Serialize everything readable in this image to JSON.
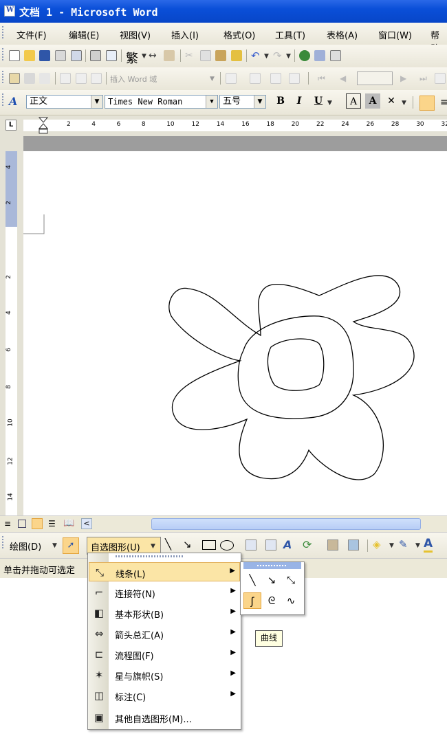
{
  "window": {
    "title": "文档 1 - Microsoft Word"
  },
  "menu": [
    "文件(F)",
    "编辑(E)",
    "视图(V)",
    "插入(I)",
    "格式(O)",
    "工具(T)",
    "表格(A)",
    "窗口(W)",
    "帮助"
  ],
  "std_toolbar": {
    "font_variant_label": "繁"
  },
  "mail_toolbar": {
    "insert_field_label": "插入 Word 域"
  },
  "format_toolbar": {
    "style": "正文",
    "font": "Times New Roman",
    "size": "五号",
    "bold": "B",
    "italic": "I",
    "underline": "U",
    "char_border": "A",
    "char_shade": "A"
  },
  "ruler": {
    "ticks": [
      "2",
      "4",
      "6",
      "8",
      "10",
      "12",
      "14",
      "16",
      "18",
      "20",
      "22",
      "24",
      "26",
      "28",
      "30",
      "32"
    ]
  },
  "vruler": {
    "ticks": [
      "4",
      "2",
      "2",
      "4",
      "6",
      "8",
      "10",
      "12",
      "14"
    ]
  },
  "draw_toolbar": {
    "draw_label": "绘图(D)",
    "autoshapes_label": "自选图形(U)"
  },
  "status": {
    "text": "单击并拖动可选定"
  },
  "autoshapes_menu": {
    "items": [
      {
        "label": "线条(L)",
        "icon": "lines-icon",
        "submenu": true,
        "highlighted": true
      },
      {
        "label": "连接符(N)",
        "icon": "connector-icon",
        "submenu": true
      },
      {
        "label": "基本形状(B)",
        "icon": "basic-shapes-icon",
        "submenu": true
      },
      {
        "label": "箭头总汇(A)",
        "icon": "block-arrows-icon",
        "submenu": true
      },
      {
        "label": "流程图(F)",
        "icon": "flowchart-icon",
        "submenu": true
      },
      {
        "label": "星与旗帜(S)",
        "icon": "stars-banners-icon",
        "submenu": true
      },
      {
        "label": "标注(C)",
        "icon": "callouts-icon",
        "submenu": true
      },
      {
        "label": "其他自选图形(M)...",
        "icon": "more-autoshapes-icon",
        "submenu": false
      }
    ]
  },
  "lines_submenu": {
    "tools": [
      "line-icon",
      "arrow-icon",
      "double-arrow-icon",
      "curve-icon",
      "freeform-icon",
      "scribble-icon"
    ],
    "selected": "curve-icon"
  },
  "tooltip": {
    "text": "曲线"
  }
}
